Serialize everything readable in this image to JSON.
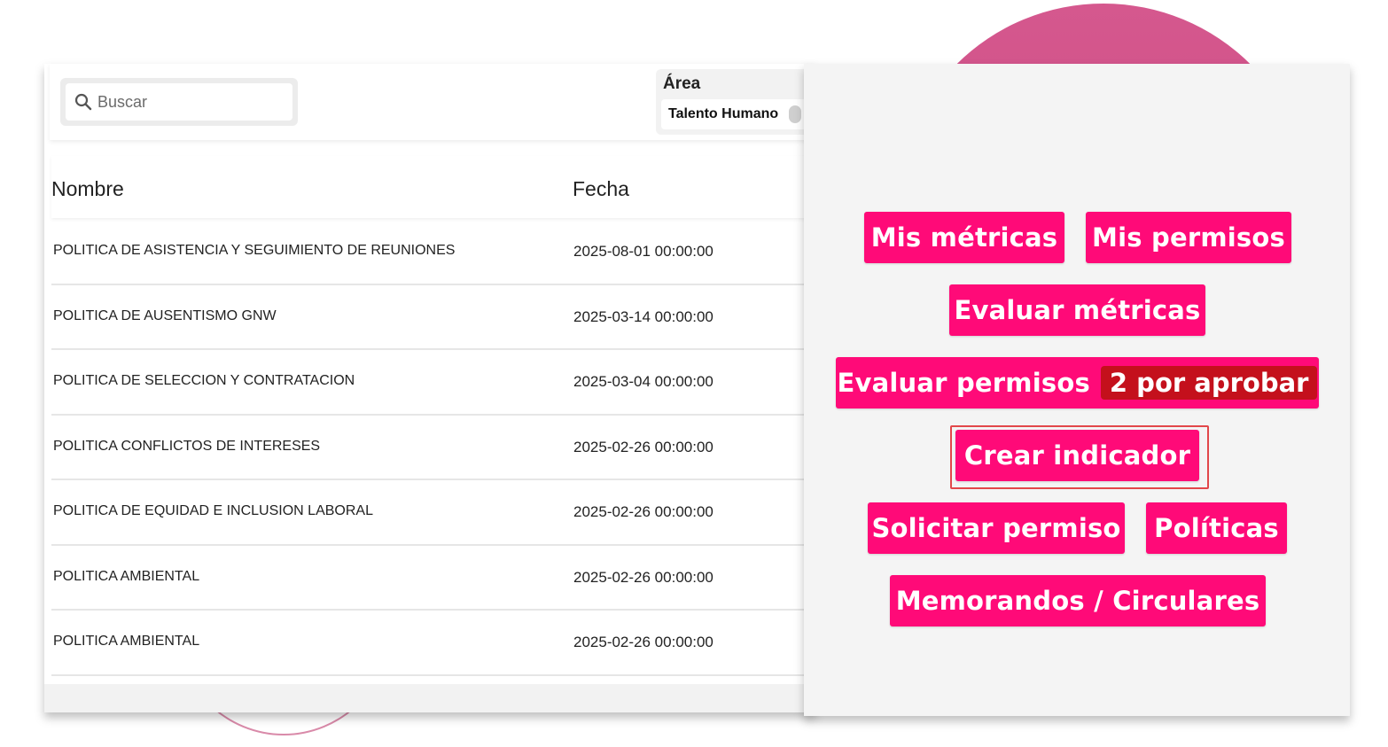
{
  "search": {
    "placeholder": "Buscar"
  },
  "filter": {
    "label": "Área",
    "value": "Talento Humano"
  },
  "table": {
    "headers": {
      "name": "Nombre",
      "date": "Fecha"
    },
    "rows": [
      {
        "name": "POLITICA DE ASISTENCIA Y SEGUIMIENTO DE REUNIONES",
        "date": "2025-08-01 00:00:00"
      },
      {
        "name": "POLITICA DE AUSENTISMO GNW",
        "date": "2025-03-14 00:00:00"
      },
      {
        "name": "POLITICA DE SELECCION Y CONTRATACION",
        "date": "2025-03-04 00:00:00"
      },
      {
        "name": "POLITICA CONFLICTOS DE INTERESES",
        "date": "2025-02-26 00:00:00"
      },
      {
        "name": "POLITICA DE EQUIDAD E INCLUSION LABORAL",
        "date": "2025-02-26 00:00:00"
      },
      {
        "name": "POLITICA AMBIENTAL",
        "date": "2025-02-26 00:00:00"
      },
      {
        "name": "POLITICA AMBIENTAL",
        "date": "2025-02-26 00:00:00"
      }
    ]
  },
  "actions": {
    "mis_metricas": "Mis métricas",
    "mis_permisos": "Mis permisos",
    "evaluar_metricas": "Evaluar métricas",
    "evaluar_permisos": "Evaluar permisos",
    "evaluar_permisos_badge": "2 por aprobar",
    "crear_indicador": "Crear indicador",
    "solicitar_permiso": "Solicitar permiso",
    "politicas": "Políticas",
    "memorandos": "Memorandos / Circulares"
  },
  "colors": {
    "button": "#ff0a78",
    "badge": "#c4101c",
    "focus_ring": "#e2474a",
    "accent_circle": "#d5588e"
  },
  "icons": {
    "search": "search-icon"
  }
}
